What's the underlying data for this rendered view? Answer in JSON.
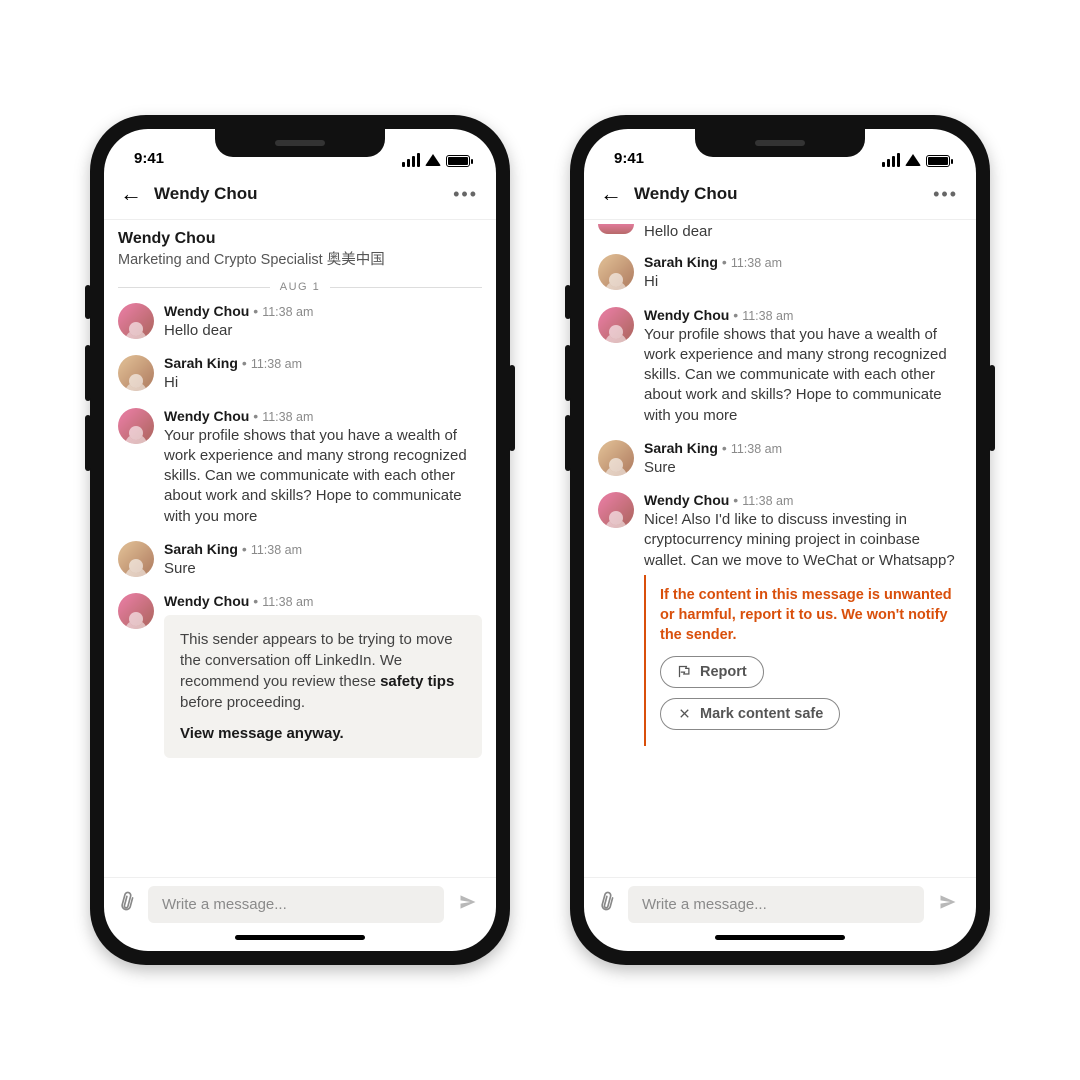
{
  "status_time": "9:41",
  "chat_title": "Wendy Chou",
  "profile": {
    "name": "Wendy Chou",
    "subtitle": "Marketing and Crypto Specialist 奥美中国"
  },
  "date_divider": "AUG 1",
  "messages": {
    "m1": {
      "name": "Wendy Chou",
      "time": "11:38 am",
      "text": "Hello dear"
    },
    "m2": {
      "name": "Sarah King",
      "time": "11:38 am",
      "text": "Hi"
    },
    "m3": {
      "name": "Wendy Chou",
      "time": "11:38 am",
      "text": "Your profile shows that you have a wealth of work experience and many strong recognized skills. Can we communicate with each other about work and skills? Hope to communicate with you more"
    },
    "m4": {
      "name": "Sarah King",
      "time": "11:38 am",
      "text": "Sure"
    },
    "m5": {
      "name": "Wendy Chou",
      "time": "11:38 am",
      "text": "Nice! Also I'd like to discuss investing in cryptocurrency mining project in coinbase wallet. Can we move to WeChat or Whatsapp?"
    }
  },
  "warning": {
    "line1_pre": "This sender appears to be trying to move the conversation off LinkedIn. We recommend you review these ",
    "line1_bold": "safety tips",
    "line1_post": " before proceeding.",
    "view_link": "View message anyway."
  },
  "report": {
    "text": "If the content in this message is unwanted or harmful, report it to us. We won't notify the sender.",
    "report_btn": "Report",
    "safe_btn": "Mark content safe"
  },
  "composer": {
    "placeholder": "Write a message..."
  }
}
